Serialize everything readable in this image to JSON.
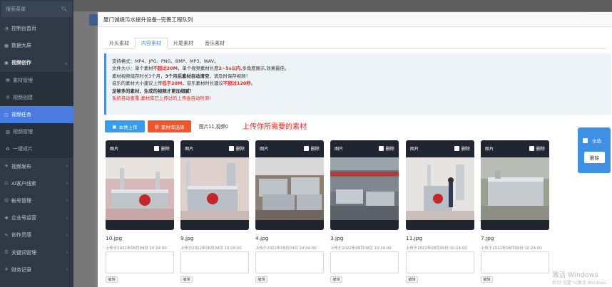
{
  "sidebar": {
    "search_placeholder": "搜索菜单",
    "items": [
      {
        "label": "控制台首页",
        "icon": "dashboard-icon"
      },
      {
        "label": "数据大屏",
        "icon": "screen-icon"
      },
      {
        "label": "视频创作",
        "icon": "video-icon"
      },
      {
        "label": "素材管理",
        "icon": "folder-icon"
      },
      {
        "label": "视频创建",
        "icon": "create-icon"
      },
      {
        "label": "视频任务",
        "icon": "task-icon"
      },
      {
        "label": "视频管理",
        "icon": "list-icon"
      },
      {
        "label": "一键成片",
        "icon": "gear-icon"
      },
      {
        "label": "视频发布",
        "icon": "publish-icon"
      },
      {
        "label": "AI客户线索",
        "icon": "ai-icon"
      },
      {
        "label": "帐号管理",
        "icon": "user-icon"
      },
      {
        "label": "企业号运营",
        "icon": "enterprise-icon"
      },
      {
        "label": "创作灵感",
        "icon": "bulb-icon"
      },
      {
        "label": "关键词管理",
        "icon": "key-icon"
      },
      {
        "label": "财务记录",
        "icon": "money-icon"
      }
    ]
  },
  "modal": {
    "title": "厦门诚缇污水提升设备--完善工程队列",
    "tabs": [
      "片头素材",
      "内容素材",
      "片尾素材",
      "音乐素材"
    ],
    "notice": {
      "l1": "支持格式：MP4、JPG、PNG、BMP、MP3、WAV。",
      "l2a": "文件大小：单个素材",
      "l2b": "不超过20M",
      "l2c": "，单个视频素材长度",
      "l2d": "2~5s以内",
      "l2e": ",多角度展示,效果最佳。",
      "l3a": "素材视频储存时长3个月，",
      "l3b": "3个月后素材自动清空",
      "l3c": "，请及时保存视频！",
      "l4a": "音乐的素材大小建议上传",
      "l4b": "低于20M",
      "l4c": "，音乐素材时长建议",
      "l4d": "不超过120秒",
      "l4e": "。",
      "l5": "足够多的素材，生成的视频才更加细腻！",
      "l6": "系统自动查重,素材库已上传过的上传会自动检测!"
    },
    "upload_label": "本地上传",
    "library_label": "素材库选择",
    "count_text": "图片11,视频0",
    "hint": "上传你所需要的素材",
    "card_type": "图片",
    "delete_label": "删除",
    "edit_label": "编辑",
    "select_all": "全选",
    "batch_delete": "删除",
    "files": [
      {
        "name": "10.jpg",
        "date": "上传于2021年08月09日 10:24:00"
      },
      {
        "name": "9.jpg",
        "date": "上传于2022年08月09日 10:24:00"
      },
      {
        "name": "4.jpg",
        "date": "上传于2022年08月09日 10:24:00"
      },
      {
        "name": "3.jpg",
        "date": "上传于2022年08月09日 10:24:00"
      },
      {
        "name": "11.jpg",
        "date": "上传于2022年08月09日 10:24:00"
      },
      {
        "name": "7.jpg",
        "date": "上传于2022年08月09日 10:24:00"
      }
    ]
  },
  "watermark": {
    "line1": "激活 Windows",
    "line2": "转到\"设置\"以激活 Windows"
  }
}
